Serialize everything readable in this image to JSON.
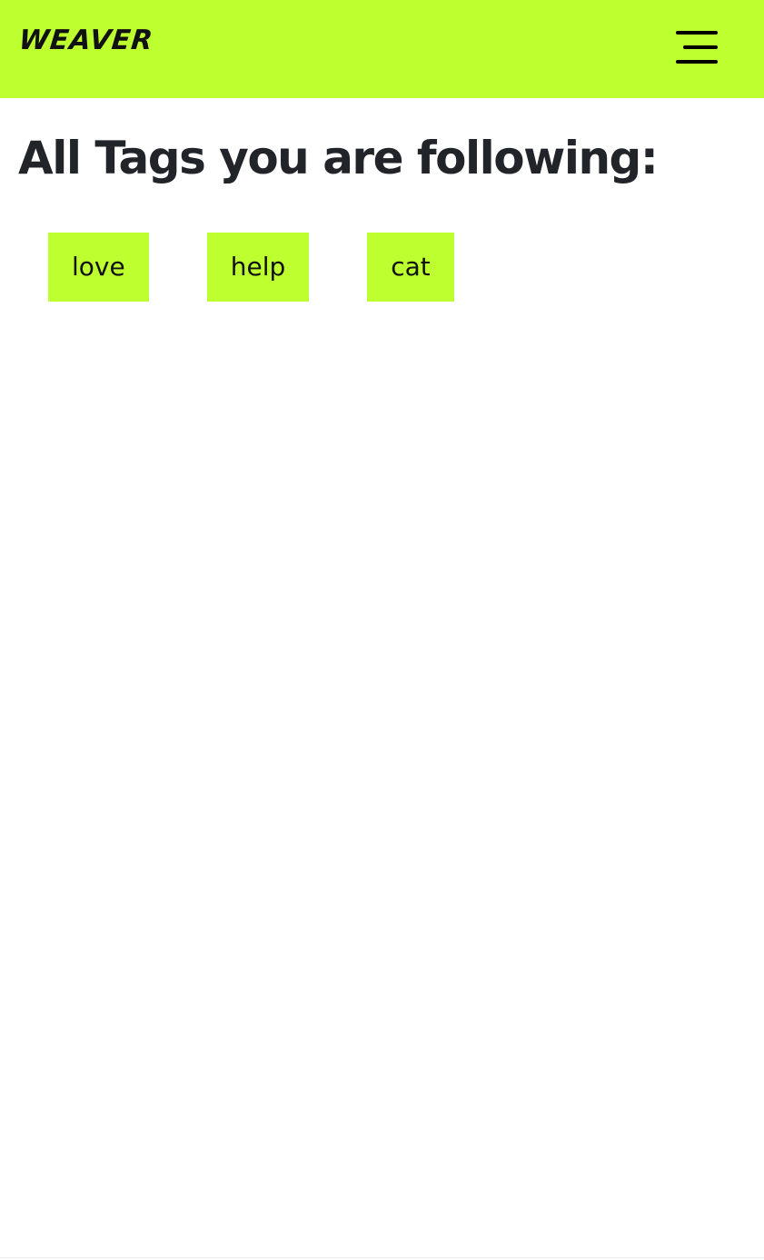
{
  "navbar": {
    "brand": "WEAVER",
    "menu_icon": "hamburger-menu-icon",
    "background_color": "#bdff2f"
  },
  "main": {
    "heading": "All Tags you are following:",
    "tags": [
      {
        "label": "love"
      },
      {
        "label": "help"
      },
      {
        "label": "cat"
      }
    ],
    "tag_background_color": "#bdff2f"
  }
}
